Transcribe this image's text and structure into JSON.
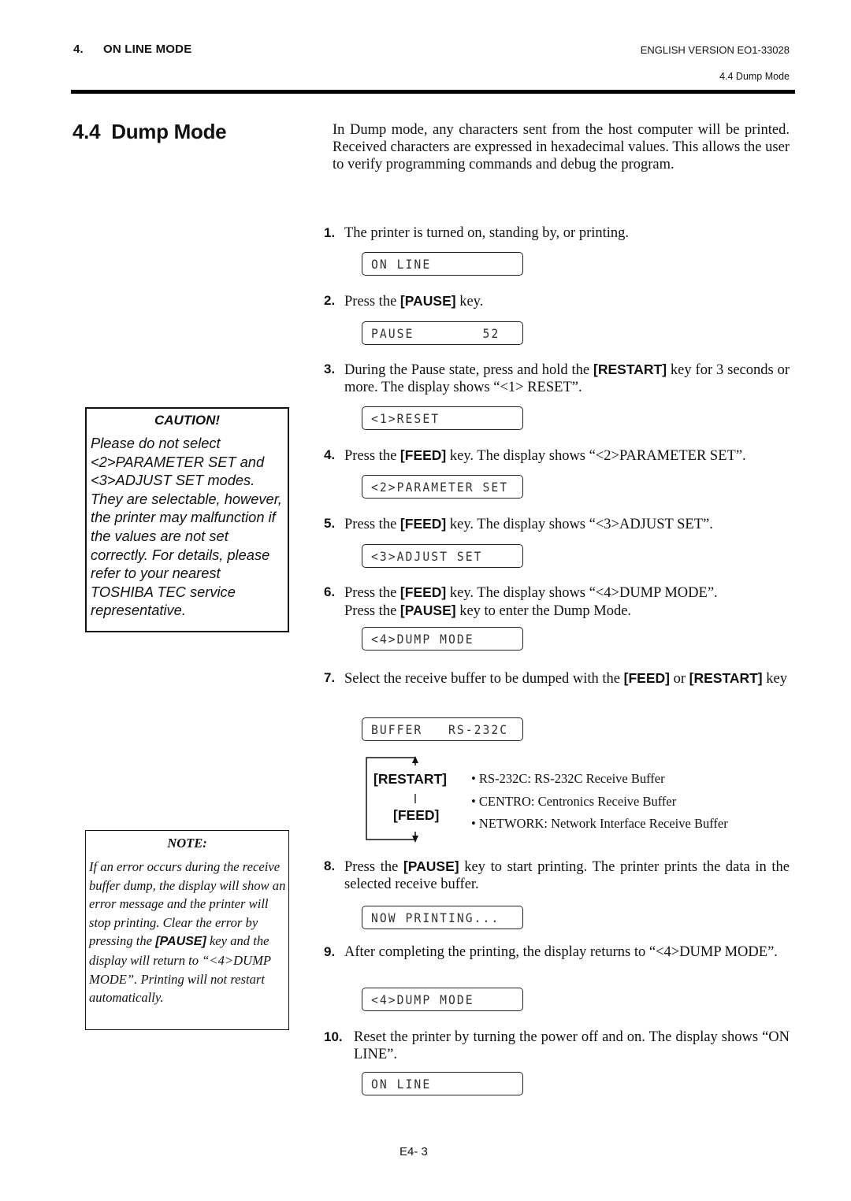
{
  "header": {
    "chapter_number": "4.",
    "chapter_title": "ON LINE MODE",
    "version": "ENGLISH VERSION EO1-33028",
    "section_ref": "4.4 Dump Mode"
  },
  "section": {
    "number": "4.4",
    "title": "Dump Mode"
  },
  "intro": "In Dump mode, any characters sent from the host computer will be printed. Received characters are expressed in hexadecimal values. This allows the user to verify programming commands and debug the program.",
  "steps": [
    {
      "num": "1.",
      "text": "The printer is turned on, standing by, or printing.",
      "display": "ON LINE"
    },
    {
      "num": "2.",
      "pre": "Press the ",
      "key": "[PAUSE]",
      "post": " key.",
      "display": "PAUSE        52"
    },
    {
      "num": "3.",
      "pre": "During the Pause state, press and hold the ",
      "key": "[RESTART]",
      "post": " key for 3 seconds or more.  The display shows “<1> RESET”.",
      "display": "<1>RESET"
    },
    {
      "num": "4.",
      "pre": "Press the ",
      "key": "[FEED]",
      "post": " key.  The display shows “<2>PARAMETER SET”.",
      "display": "<2>PARAMETER SET"
    },
    {
      "num": "5.",
      "pre": "Press the ",
      "key": "[FEED]",
      "post": " key.  The display shows “<3>ADJUST SET”.",
      "display": "<3>ADJUST SET"
    },
    {
      "num": "6.",
      "pre": "Press the ",
      "key": "[FEED]",
      "post": " key.  The display shows “<4>DUMP MODE”.",
      "line2_pre": "Press the ",
      "line2_key": "[PAUSE]",
      "line2_post": " key to enter the Dump Mode.",
      "display": "<4>DUMP MODE"
    },
    {
      "num": "7.",
      "pre": "Select the receive buffer to be dumped with the ",
      "key": "[FEED]",
      "mid": " or ",
      "key2": "[RESTART]",
      "post": " key",
      "display": "BUFFER   RS-232C"
    },
    {
      "num": "8.",
      "pre": "Press the ",
      "key": "[PAUSE]",
      "post": " key to start printing.  The printer prints the data in the selected receive buffer.",
      "display": "NOW PRINTING..."
    },
    {
      "num": "9.",
      "text": "After completing the printing, the display returns to “<4>DUMP MODE”.",
      "display": "<4>DUMP MODE"
    },
    {
      "num": "10.",
      "text": "Reset the printer by turning the power off and on.  The display shows “ON LINE”.",
      "display": "ON LINE"
    }
  ],
  "cycle": {
    "top_key": "[RESTART]",
    "bottom_key": "[FEED]",
    "separator": "|"
  },
  "buffers": [
    "• RS-232C:  RS-232C Receive Buffer",
    "• CENTRO:  Centronics Receive Buffer",
    "• NETWORK: Network Interface Receive Buffer"
  ],
  "caution": {
    "title": "CAUTION!",
    "body": "Please do not select <2>PARAMETER SET and <3>ADJUST SET modes. They are selectable, however, the printer may malfunction if the values are not set correctly.  For details, please refer to your nearest TOSHIBA TEC service representative."
  },
  "note": {
    "title": "NOTE:",
    "pre": "If an error occurs during the receive buffer dump, the display will show an error message and the printer will stop printing. Clear the error by pressing the ",
    "key": "[PAUSE]",
    "post": " key and the display will return to “<4>DUMP MODE”.  Printing will not restart automatically."
  },
  "footer": {
    "page": "E4- 3"
  }
}
